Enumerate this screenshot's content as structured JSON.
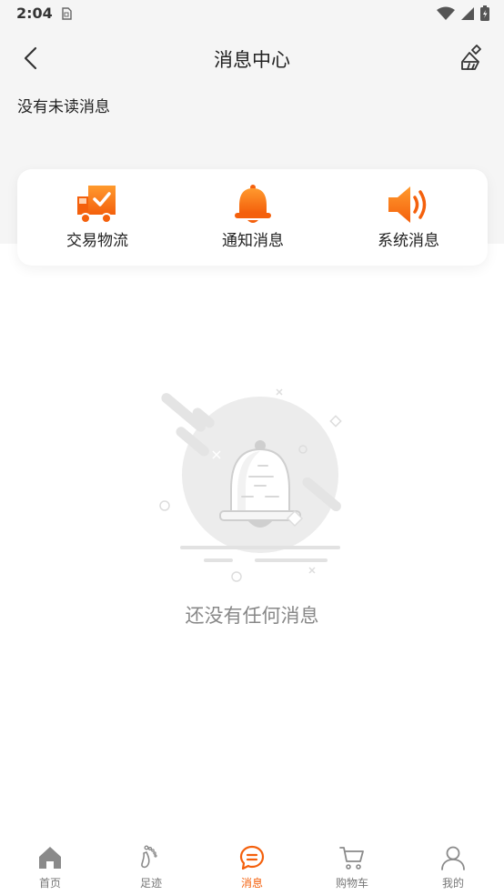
{
  "status_bar": {
    "time": "2:04"
  },
  "header": {
    "title": "消息中心"
  },
  "unread_status": "没有未读消息",
  "categories": [
    {
      "label": "交易物流",
      "icon": "truck-check-icon"
    },
    {
      "label": "通知消息",
      "icon": "bell-icon"
    },
    {
      "label": "系统消息",
      "icon": "speaker-icon"
    }
  ],
  "empty_state": {
    "text": "还没有任何消息",
    "icon": "empty-bell-illustration"
  },
  "bottom_nav": [
    {
      "label": "首页",
      "icon": "home-icon",
      "active": false
    },
    {
      "label": "足迹",
      "icon": "footprint-icon",
      "active": false
    },
    {
      "label": "消息",
      "icon": "message-icon",
      "active": true
    },
    {
      "label": "购物车",
      "icon": "cart-icon",
      "active": false
    },
    {
      "label": "我的",
      "icon": "user-icon",
      "active": false
    }
  ],
  "colors": {
    "accent": "#f4600c",
    "accent_light": "#ff8a2a",
    "background_top": "#f5f5f5"
  }
}
